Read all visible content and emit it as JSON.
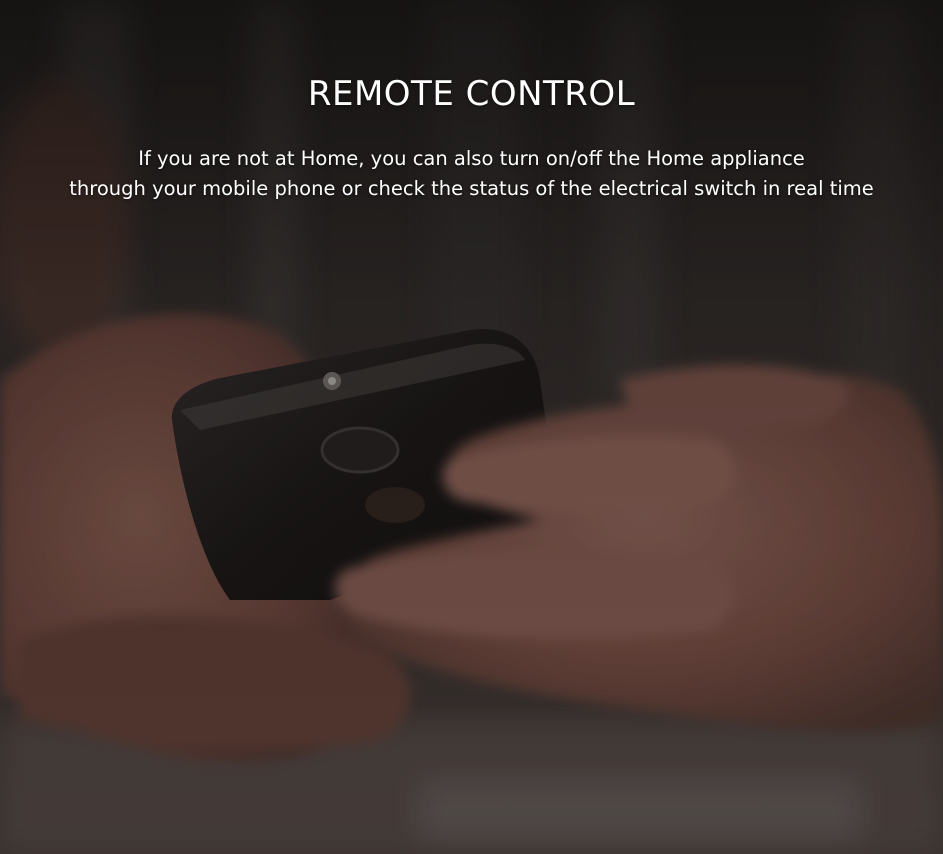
{
  "banner": {
    "title": "REMOTE CONTROL",
    "description_line_1": "If you are not at Home, you can also turn on/off the Home appliance",
    "description_line_2": "through your mobile phone or check the status of the electrical switch in real time",
    "text_color": "#ffffff",
    "overlay_color": "#2b2624"
  },
  "photo": {
    "subject": "hands-holding-smartphone"
  }
}
